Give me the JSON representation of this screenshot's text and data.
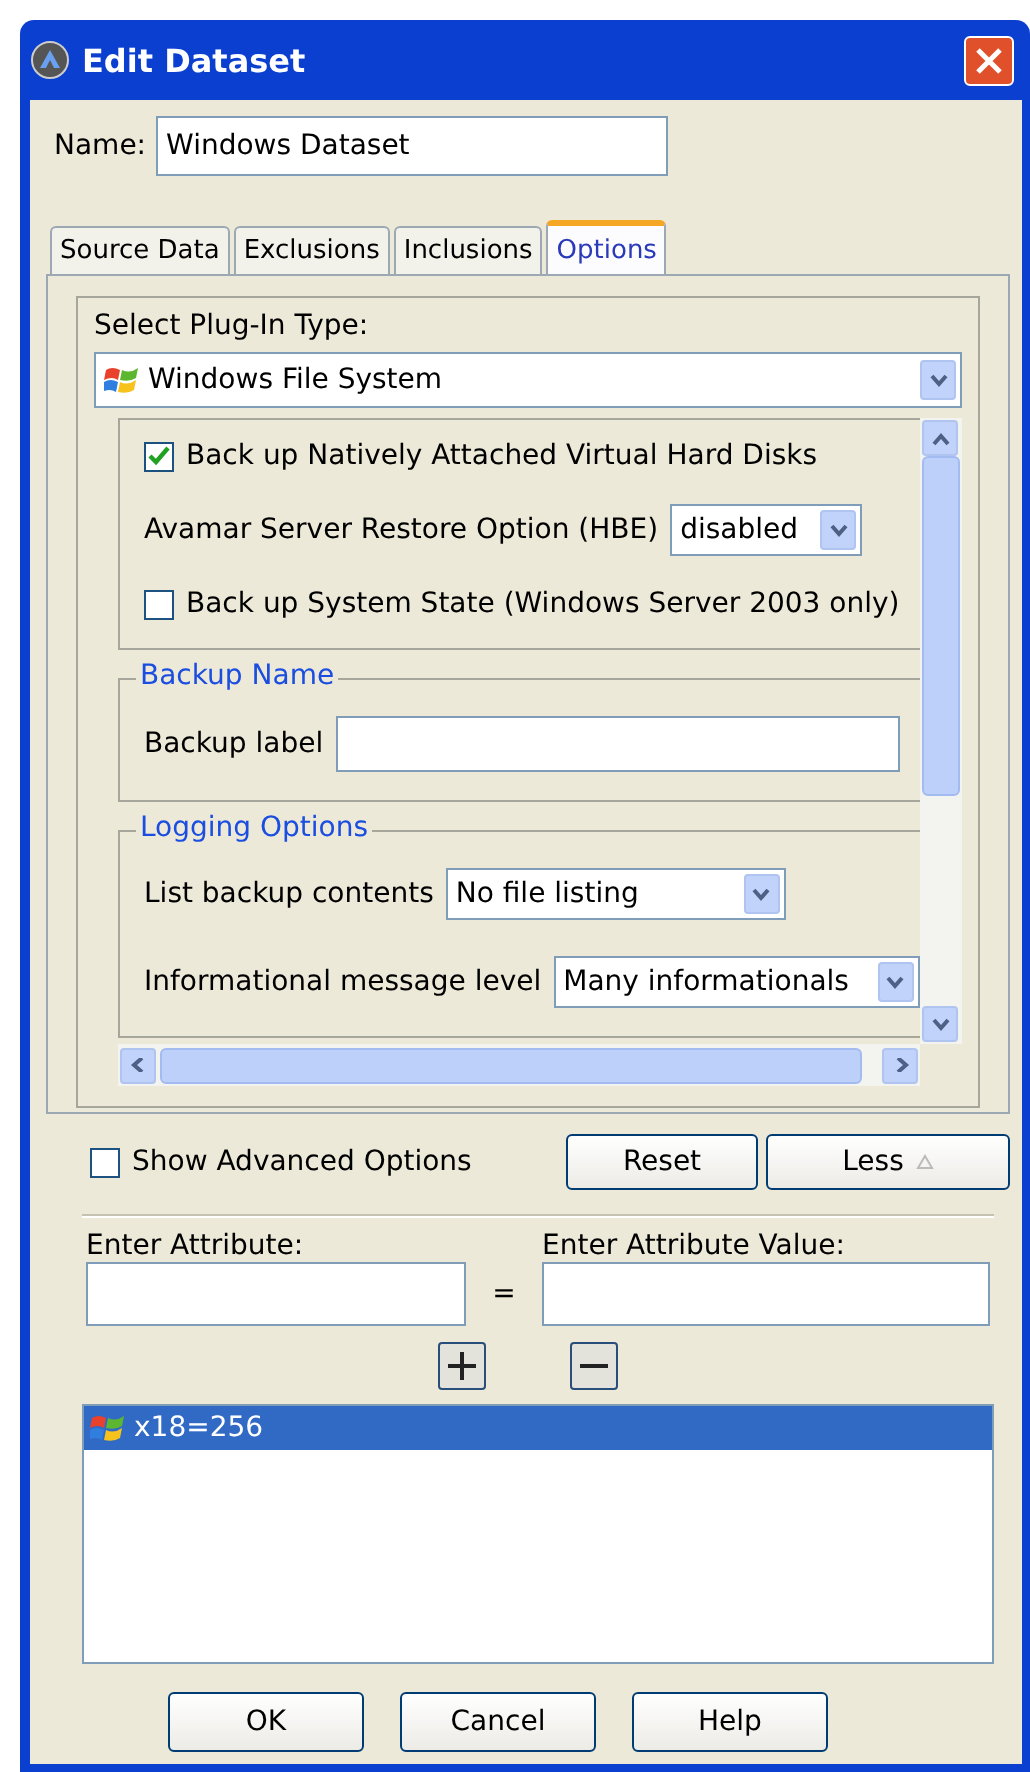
{
  "window": {
    "title": "Edit Dataset"
  },
  "name_field": {
    "label": "Name:",
    "value": "Windows Dataset"
  },
  "tabs": [
    {
      "label": "Source Data",
      "selected": false
    },
    {
      "label": "Exclusions",
      "selected": false
    },
    {
      "label": "Inclusions",
      "selected": false
    },
    {
      "label": "Options",
      "selected": true
    }
  ],
  "plugin": {
    "label": "Select Plug-In Type:",
    "value": "Windows File System"
  },
  "options": [
    {
      "kind": "checkbox",
      "label": "Back up Natively Attached Virtual Hard Disks",
      "checked": true
    },
    {
      "kind": "dropdown",
      "label": "Avamar Server Restore Option (HBE)",
      "value": "disabled"
    },
    {
      "kind": "checkbox",
      "label": "Back up System State (Windows Server 2003 only)",
      "checked": false
    }
  ],
  "sections": [
    {
      "title": "Backup Name",
      "rows": [
        {
          "kind": "text",
          "label": "Backup label"
        }
      ]
    },
    {
      "title": "Logging Options",
      "rows": [
        {
          "kind": "dropdown",
          "label": "List backup contents",
          "value": "No file listing"
        },
        {
          "kind": "dropdown",
          "label": "Informational message level",
          "value": "Many informationals"
        }
      ]
    }
  ],
  "show_advanced": {
    "label": "Show Advanced Options",
    "checked": false
  },
  "panel_buttons": [
    "Reset",
    "Less"
  ],
  "attribute": {
    "label": "Enter Attribute:",
    "equals": "=",
    "value_label": "Enter Attribute Value:"
  },
  "attributes": [
    {
      "text": "x18=256",
      "selected": true
    }
  ],
  "buttons": [
    "OK",
    "Cancel",
    "Help"
  ]
}
